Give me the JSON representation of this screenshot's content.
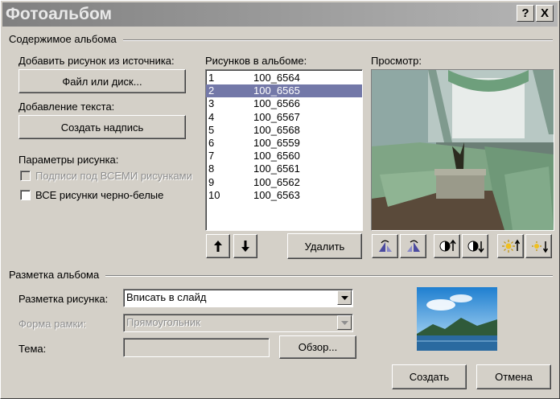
{
  "window": {
    "title": "Фотоальбом",
    "help_label": "?",
    "close_label": "X"
  },
  "content_group": {
    "title": "Содержимое альбома",
    "add_from_label": "Добавить рисунок из источника:",
    "file_button": "Файл или диск...",
    "add_text_label": "Добавление текста:",
    "textbox_button": "Создать надпись",
    "picture_options_label": "Параметры рисунка:",
    "captions_checkbox": "Подписи под ВСЕМИ рисунками",
    "captions_checked": false,
    "captions_enabled": false,
    "bw_checkbox": "ВСЕ рисунки черно-белые",
    "bw_checked": false
  },
  "pictures": {
    "label": "Рисунков в альбоме:",
    "selected_index": 1,
    "items": [
      {
        "num": "1",
        "name": "100_6564"
      },
      {
        "num": "2",
        "name": "100_6565"
      },
      {
        "num": "3",
        "name": "100_6566"
      },
      {
        "num": "4",
        "name": "100_6567"
      },
      {
        "num": "5",
        "name": "100_6568"
      },
      {
        "num": "6",
        "name": "100_6559"
      },
      {
        "num": "7",
        "name": "100_6560"
      },
      {
        "num": "8",
        "name": "100_6561"
      },
      {
        "num": "9",
        "name": "100_6562"
      },
      {
        "num": "10",
        "name": "100_6563"
      }
    ],
    "move_up_icon": "arrow-up-icon",
    "move_down_icon": "arrow-down-icon",
    "delete_button": "Удалить"
  },
  "preview": {
    "label": "Просмотр:",
    "tools": [
      "rotate-left-icon",
      "rotate-right-icon",
      "contrast-up-icon",
      "contrast-down-icon",
      "brightness-up-icon",
      "brightness-down-icon"
    ]
  },
  "layout_group": {
    "title": "Разметка альбома",
    "picture_layout_label": "Разметка рисунка:",
    "picture_layout_value": "Вписать в слайд",
    "frame_shape_label": "Форма рамки:",
    "frame_shape_value": "Прямоугольник",
    "frame_shape_enabled": false,
    "theme_label": "Тема:",
    "theme_value": "",
    "browse_button": "Обзор..."
  },
  "footer": {
    "create_button": "Создать",
    "cancel_button": "Отмена"
  },
  "colors": {
    "dialog_bg": "#d4d0c8",
    "selection": "#7378a8",
    "title_gradient_start": "#808080"
  }
}
